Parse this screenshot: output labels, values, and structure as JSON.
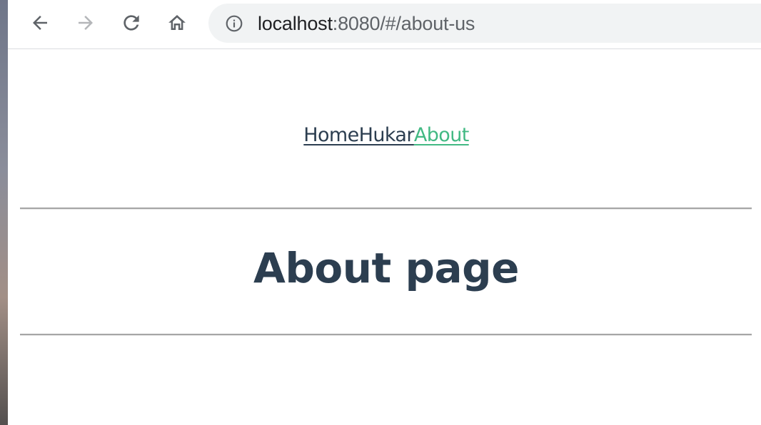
{
  "browser": {
    "url_host": "localhost",
    "url_path": ":8080/#/about-us",
    "icons": {
      "back": "arrow-left-icon",
      "forward": "arrow-right-icon",
      "reload": "reload-icon",
      "home": "home-icon",
      "site_info": "info-icon"
    },
    "forward_disabled": true
  },
  "nav": {
    "links": [
      {
        "label": "Home",
        "active": false
      },
      {
        "label": "Hukar",
        "active": false
      },
      {
        "label": "About",
        "active": true
      }
    ]
  },
  "page": {
    "title": "About page"
  },
  "colors": {
    "text": "#2c3e50",
    "active_link": "#42b983",
    "omnibox_bg": "#f1f3f4",
    "toolbar_icon": "#5f6368",
    "disabled_icon": "#b4b6b9"
  }
}
